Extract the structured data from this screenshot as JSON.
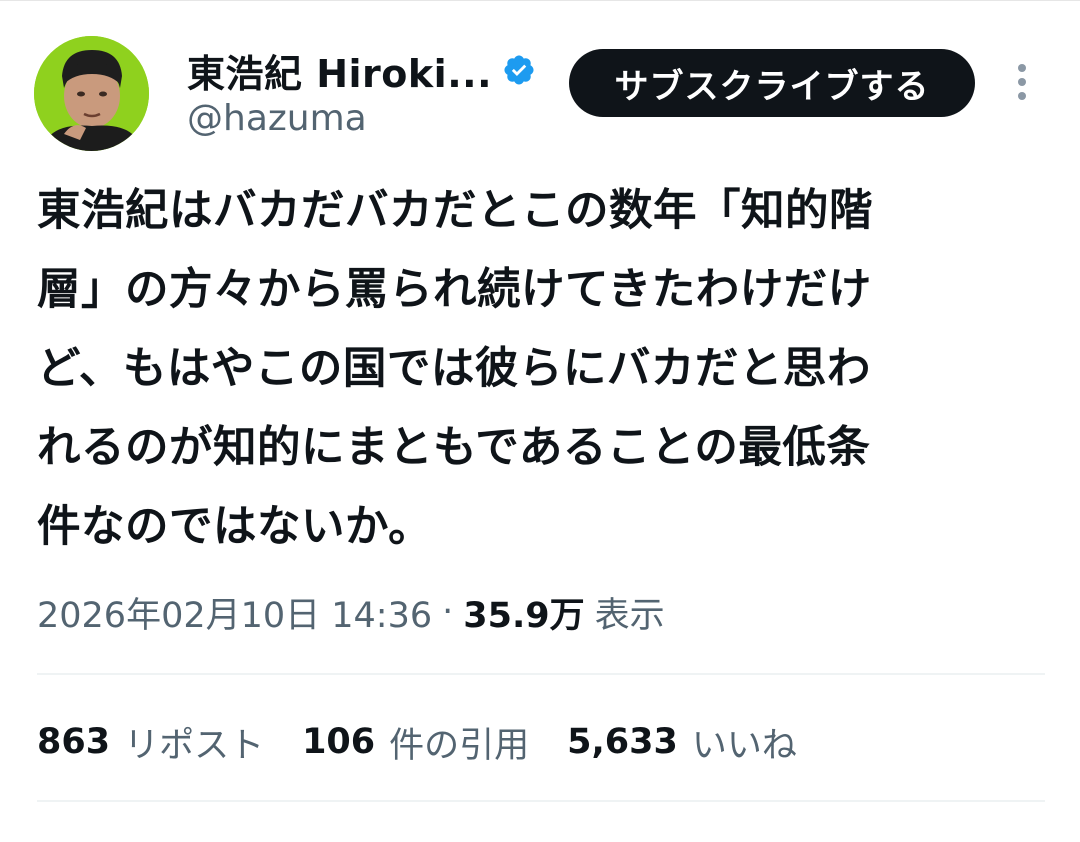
{
  "author": {
    "display_name": "東浩紀 Hiroki...",
    "handle": "@hazuma",
    "verified": true
  },
  "actions": {
    "subscribe_label": "サブスクライブする"
  },
  "tweet": {
    "text_lines": [
      "東浩紀はバカだバカだとこの数年「知的階",
      "層」の方々から罵られ続けてきたわけだけ",
      "ど、もはやこの国では彼らにバカだと思わ",
      "れるのが知的にまともであることの最低条",
      "件なのではないか。"
    ],
    "timestamp": "2026年02月10日 14:36",
    "separator": "·",
    "views_count": "35.9万",
    "views_label": "表示"
  },
  "stats": {
    "reposts": {
      "count": "863",
      "label": "リポスト"
    },
    "quotes": {
      "count": "106",
      "label": "件の引用"
    },
    "likes": {
      "count": "5,633",
      "label": "いいね"
    }
  },
  "colors": {
    "text": "#0f1419",
    "secondary": "#536471",
    "verified": "#1d9bf0",
    "button_bg": "#0f1419",
    "avatar_bg": "#8fd11e"
  }
}
